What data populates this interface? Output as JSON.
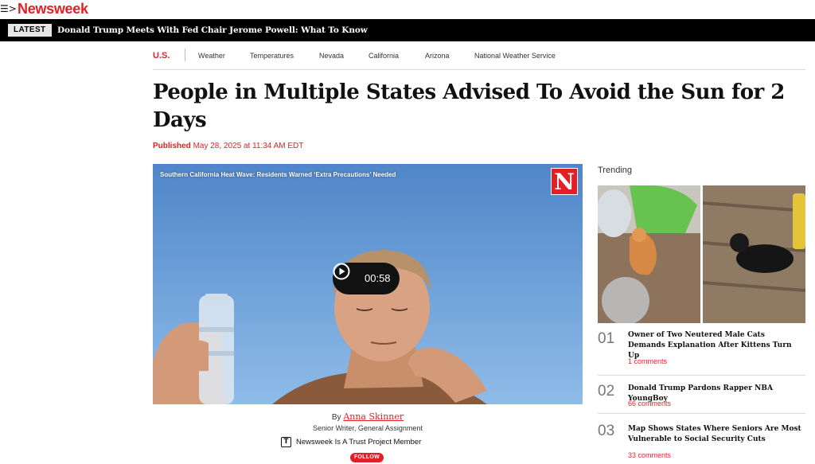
{
  "header": {
    "menu_icon_glyph": "☰>",
    "logo": "Newsweek",
    "brand_color": "#e31f26"
  },
  "latest": {
    "badge": "LATEST",
    "headline": "Donald Trump Meets With Fed Chair Jerome Powell: What To Know"
  },
  "section_nav": {
    "title": "U.S.",
    "items": [
      "Weather",
      "Temperatures",
      "Nevada",
      "California",
      "Arizona",
      "National Weather Service"
    ]
  },
  "article": {
    "headline": "People in Multiple States Advised To Avoid the Sun for 2 Days",
    "published_label": "Published",
    "published_date": "May 28, 2025 at 11:34 AM EDT"
  },
  "video": {
    "title": "Southern California Heat Wave: Residents Warned ‘Extra Precautions’ Needed",
    "badge_letter": "N",
    "duration": "00:58",
    "play_icon": "play-circle-icon"
  },
  "byline": {
    "by": "By",
    "author": "Anna Skinner",
    "role": "Senior Writer, General Assignment",
    "trust_icon_glyph": "T",
    "trust_text": "Newsweek Is A Trust Project Member",
    "follow_label": "FOLLOW"
  },
  "trending": {
    "title": "Trending",
    "items": [
      {
        "number": "01",
        "title": "Owner of Two Neutered Male Cats Demands Explanation After Kittens Turn Up",
        "comments": "1 comments"
      },
      {
        "number": "02",
        "title": "Donald Trump Pardons Rapper NBA YoungBoy",
        "comments": "66 comments"
      },
      {
        "number": "03",
        "title": "Map Shows States Where Seniors Are Most Vulnerable to Social Security Cuts",
        "comments": "33 comments"
      }
    ]
  }
}
